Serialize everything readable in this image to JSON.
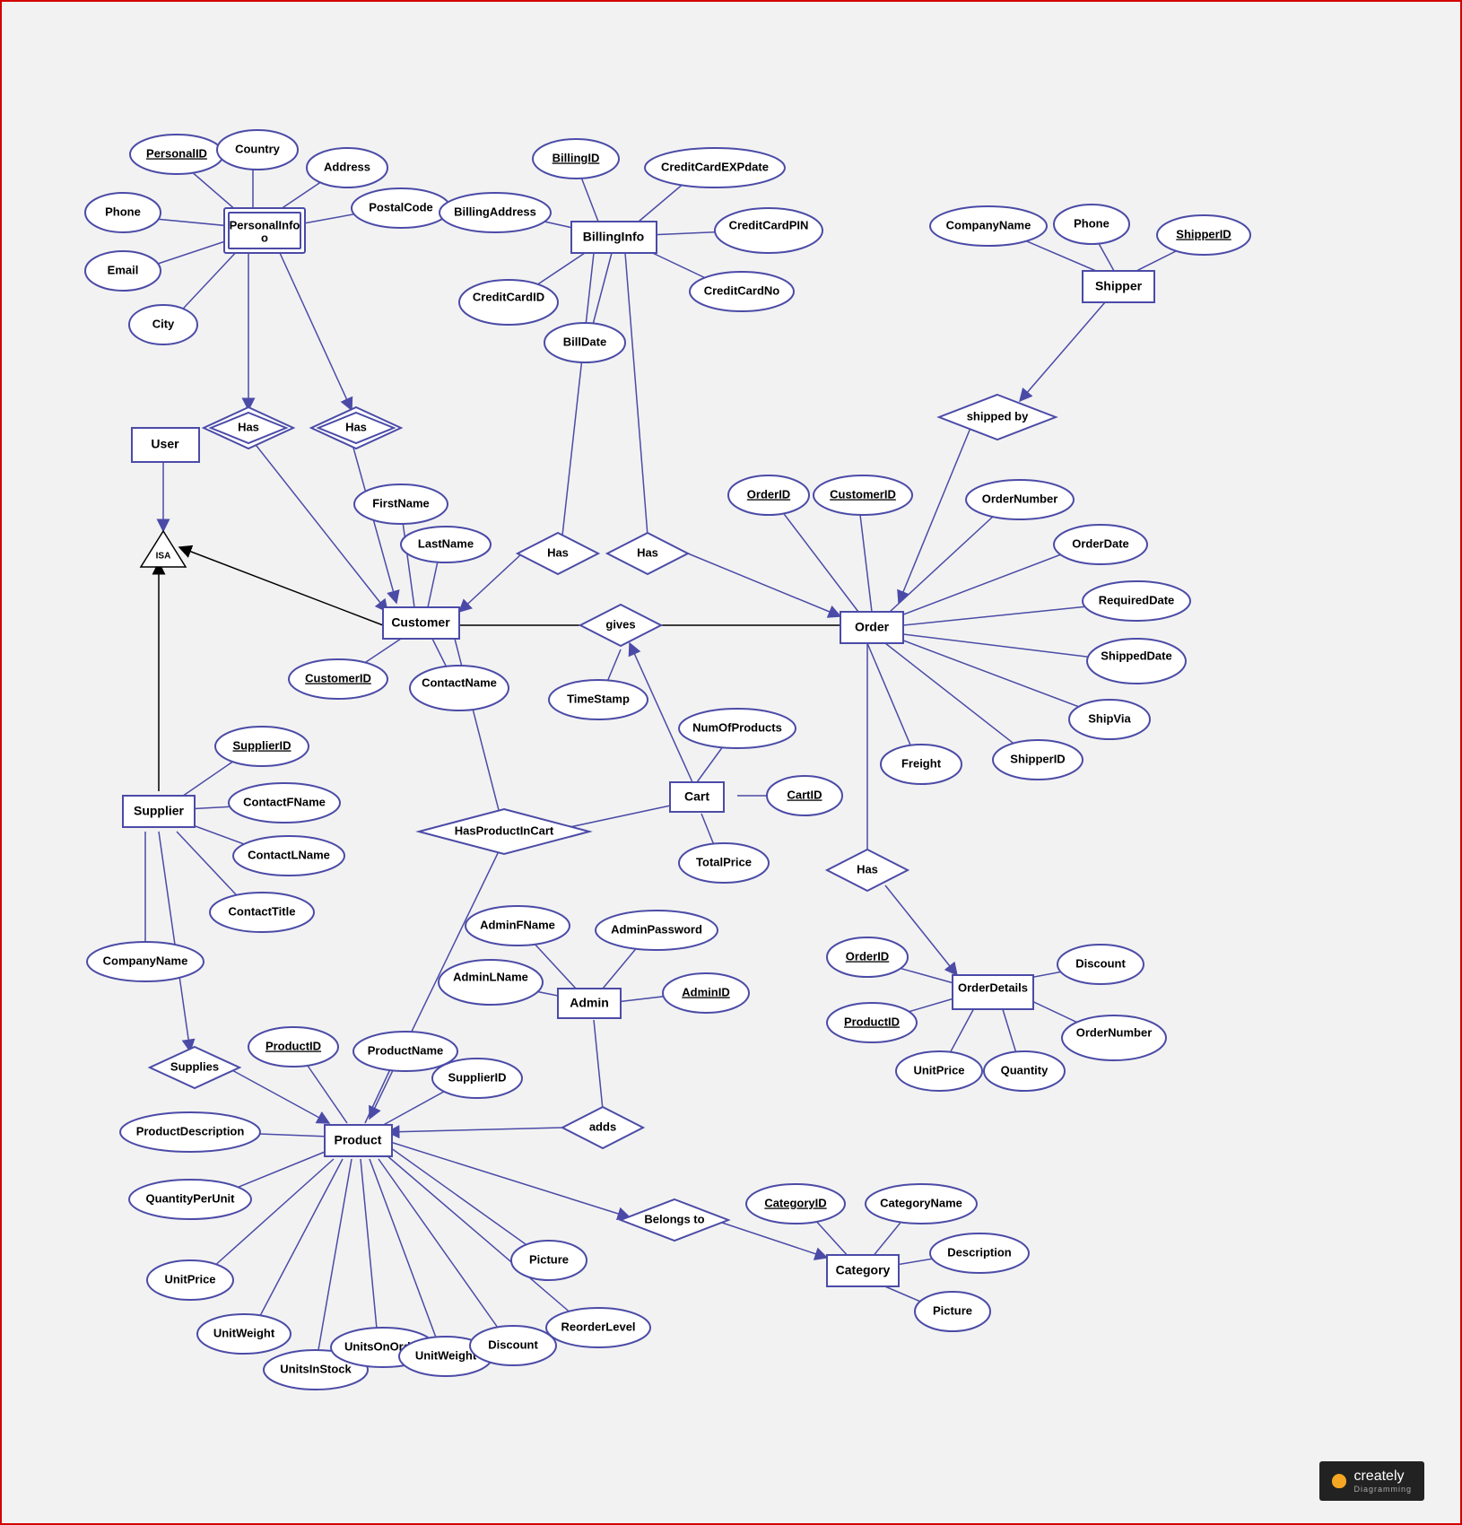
{
  "entities": {
    "personalInfo": "PersonalInfo",
    "user": "User",
    "customer": "Customer",
    "billingInfo": "BillingInfo",
    "shipper": "Shipper",
    "order": "Order",
    "cart": "Cart",
    "admin": "Admin",
    "orderDetails": "OrderDetails",
    "supplier": "Supplier",
    "product": "Product",
    "category": "Category"
  },
  "relationships": {
    "has1": "Has",
    "has2": "Has",
    "isa": "ISA",
    "hasBilling": "Has",
    "hasCart": "Has",
    "gives": "gives",
    "shippedBy": "shipped by",
    "hasOrderDetails": "Has",
    "hasProductInCart": "HasProductInCart",
    "supplies": "Supplies",
    "adds": "adds",
    "belongsTo": "Belongs to"
  },
  "attributes": {
    "personalInfo": {
      "personalID": "PersonalID",
      "country": "Country",
      "address": "Address",
      "postalCode": "PostalCode",
      "phone": "Phone",
      "email": "Email",
      "city": "City"
    },
    "billingInfo": {
      "billingID": "BillingID",
      "billingAddress": "BillingAddress",
      "creditCardEXPdate": "CreditCardEXPdate",
      "creditCardPIN": "CreditCardPIN",
      "creditCardNo": "CreditCardNo",
      "creditCardID": "CreditCardID",
      "billDate": "BillDate"
    },
    "shipper": {
      "companyName": "CompanyName",
      "phone": "Phone",
      "shipperID": "ShipperID"
    },
    "customer": {
      "firstName": "FirstName",
      "lastName": "LastName",
      "customerID": "CustomerID",
      "contactName": "ContactName"
    },
    "order": {
      "orderID": "OrderID",
      "customerID": "CustomerID",
      "orderNumber": "OrderNumber",
      "orderDate": "OrderDate",
      "requiredDate": "RequiredDate",
      "shippedDate": "ShippedDate",
      "shipVia": "ShipVia",
      "shipperID": "ShipperID",
      "freight": "Freight"
    },
    "gives": {
      "timeStamp": "TimeStamp"
    },
    "cart": {
      "cartID": "CartID",
      "numOfProducts": "NumOfProducts",
      "totalPrice": "TotalPrice"
    },
    "supplier": {
      "supplierID": "SupplierID",
      "contactFName": "ContactFName",
      "contactLName": "ContactLName",
      "contactTitle": "ContactTitle",
      "companyName": "CompanyName"
    },
    "admin": {
      "adminFName": "AdminFName",
      "adminLName": "AdminLName",
      "adminPassword": "AdminPassword",
      "adminID": "AdminID"
    },
    "orderDetails": {
      "orderID": "OrderID",
      "productID": "ProductID",
      "discount": "Discount",
      "orderNumber": "OrderNumber",
      "quantity": "Quantity",
      "unitPrice": "UnitPrice"
    },
    "product": {
      "productID": "ProductID",
      "productName": "ProductName",
      "supplierID": "SupplierID",
      "productDescription": "ProductDescription",
      "quantityPerUnit": "QuantityPerUnit",
      "unitPrice": "UnitPrice",
      "unitWeight": "UnitWeight",
      "unitsInStock": "UnitsInStock",
      "unitsOnOrder": "UnitsOnOrder",
      "unitWeight2": "UnitWeight",
      "discount": "Discount",
      "reorderLevel": "ReorderLevel",
      "picture": "Picture"
    },
    "category": {
      "categoryID": "CategoryID",
      "categoryName": "CategoryName",
      "description": "Description",
      "picture": "Picture"
    }
  },
  "brand": {
    "name": "creately",
    "tagline": "Diagramming"
  }
}
